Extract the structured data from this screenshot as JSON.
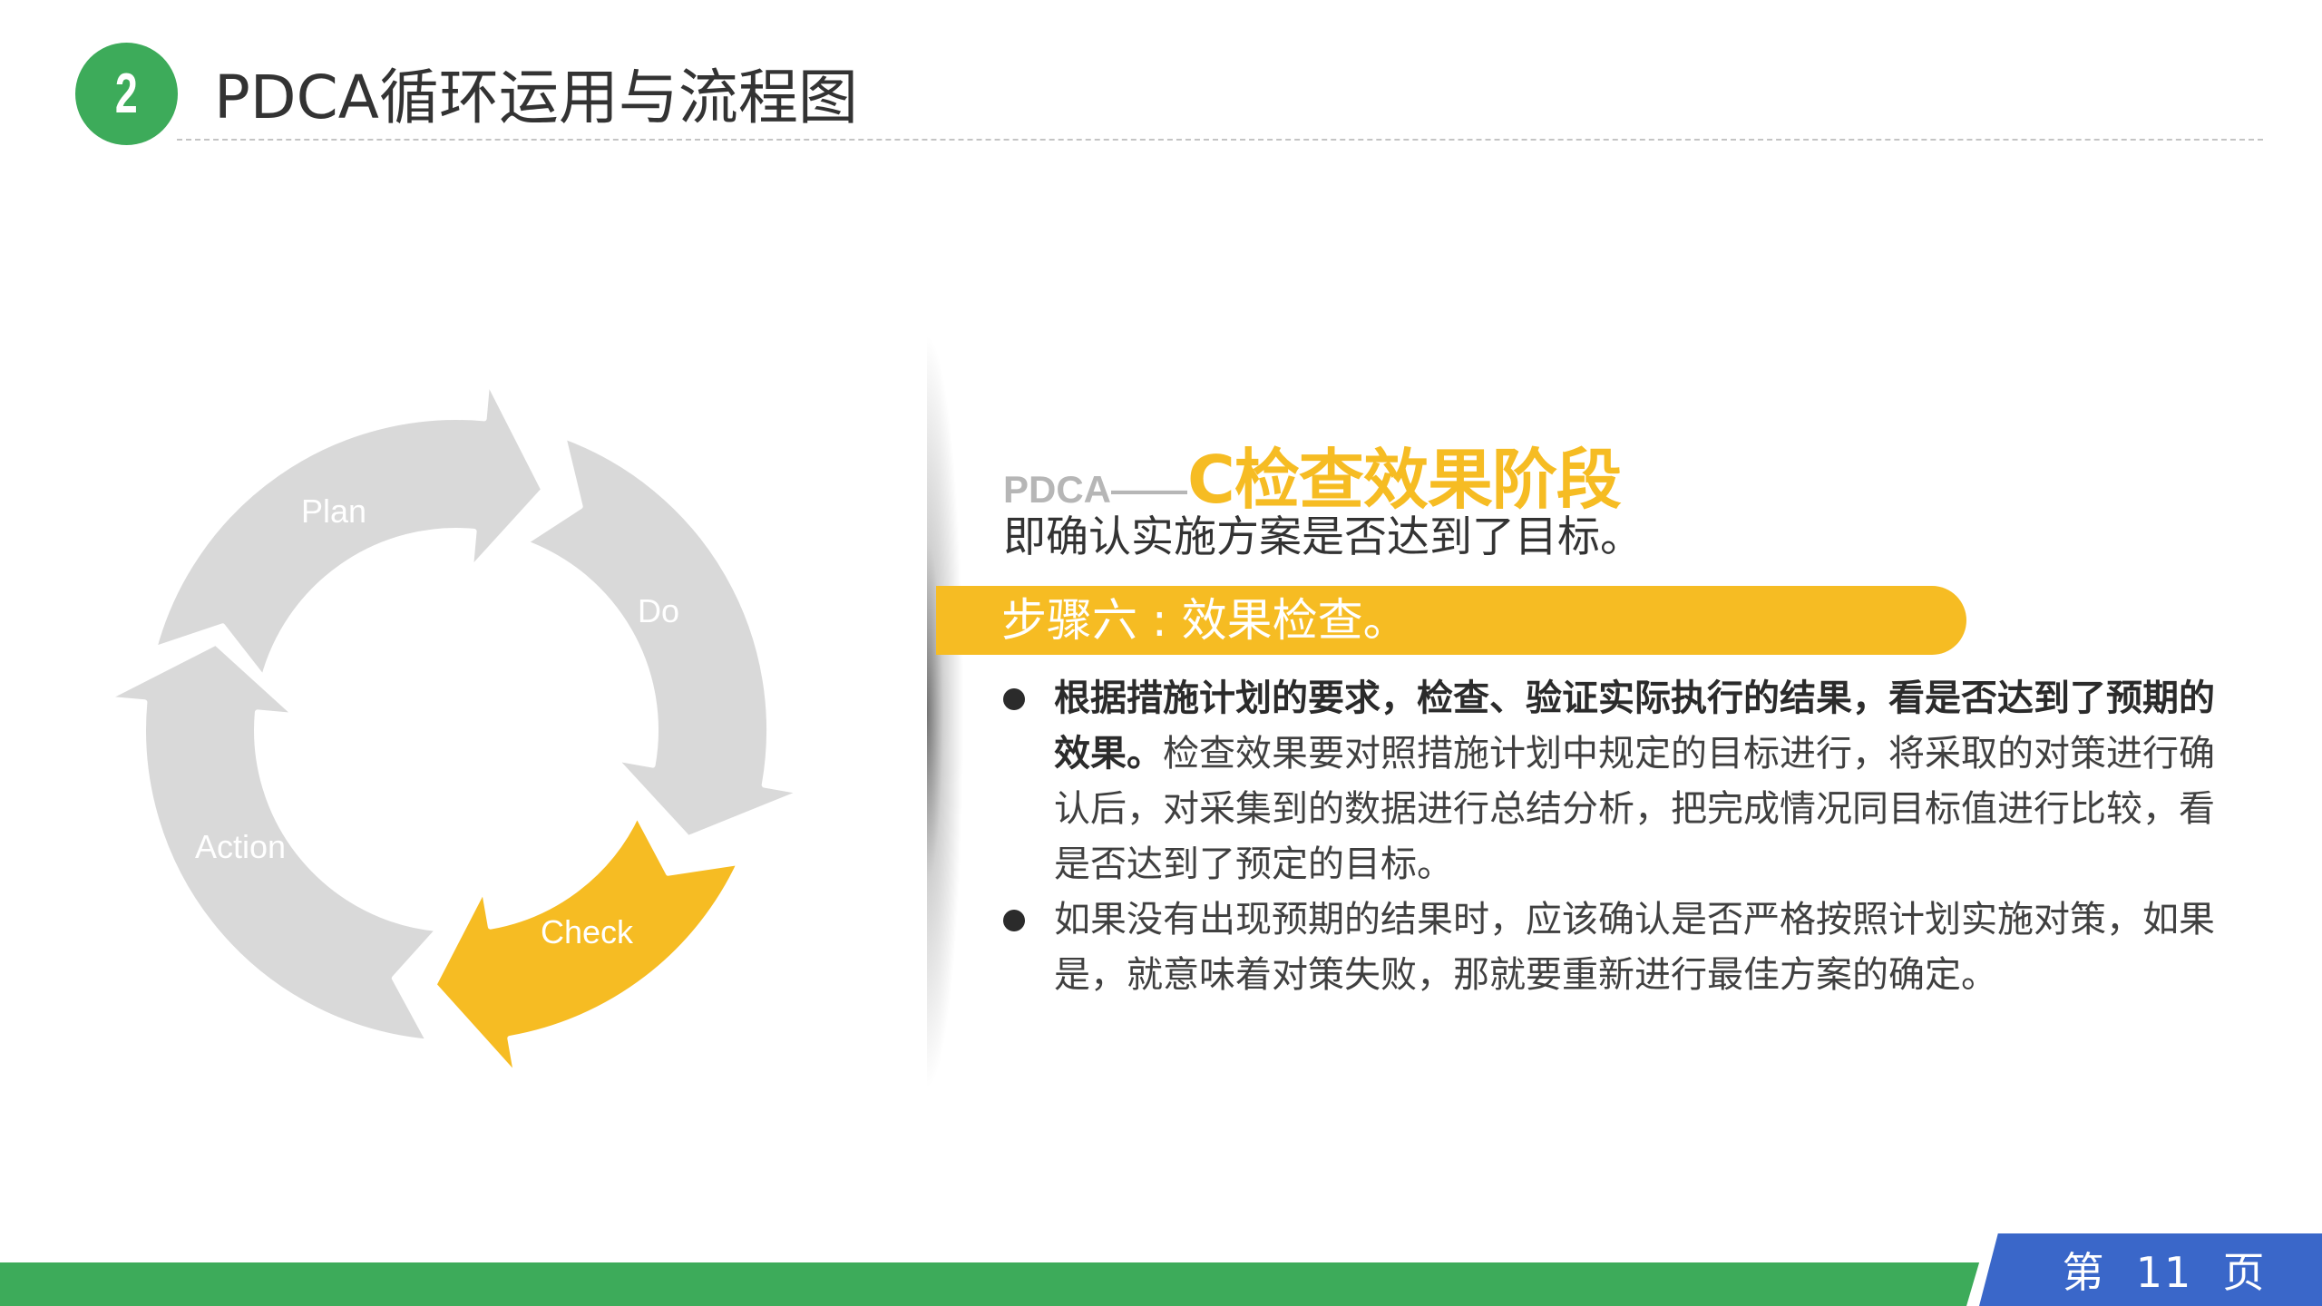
{
  "header": {
    "section_number": "2",
    "title": "PDCA循环运用与流程图"
  },
  "cycle": {
    "stages": [
      "Plan",
      "Do",
      "Check",
      "Action"
    ],
    "active_stage": "Check",
    "colors": {
      "inactive": "#d9d9d9",
      "active": "#f6bc23",
      "label": "#ffffff"
    }
  },
  "panel": {
    "prefix": "PDCA——",
    "title": "C检查效果阶段",
    "subtitle": "即确认实施方案是否达到了目标。",
    "step_label": "步骤六 : 效果检查。",
    "bullets": [
      {
        "bold": "根据措施计划的要求，检查、验证实际执行的结果，看是否达到了预期的效果。",
        "text": "检查效果要对照措施计划中规定的目标进行，将采取的对策进行确认后，对采集到的数据进行总结分析，把完成情况同目标值进行比较，看是否达到了预定的目标。"
      },
      {
        "bold": "",
        "text": "如果没有出现预期的结果时，应该确认是否严格按照计划实施对策，如果是，就意味着对策失败，那就要重新进行最佳方案的确定。"
      }
    ]
  },
  "footer": {
    "page_label": "第  11  页"
  },
  "colors": {
    "accent_green": "#3dab5a",
    "accent_yellow": "#f6bc23",
    "accent_blue": "#3a67c9"
  }
}
